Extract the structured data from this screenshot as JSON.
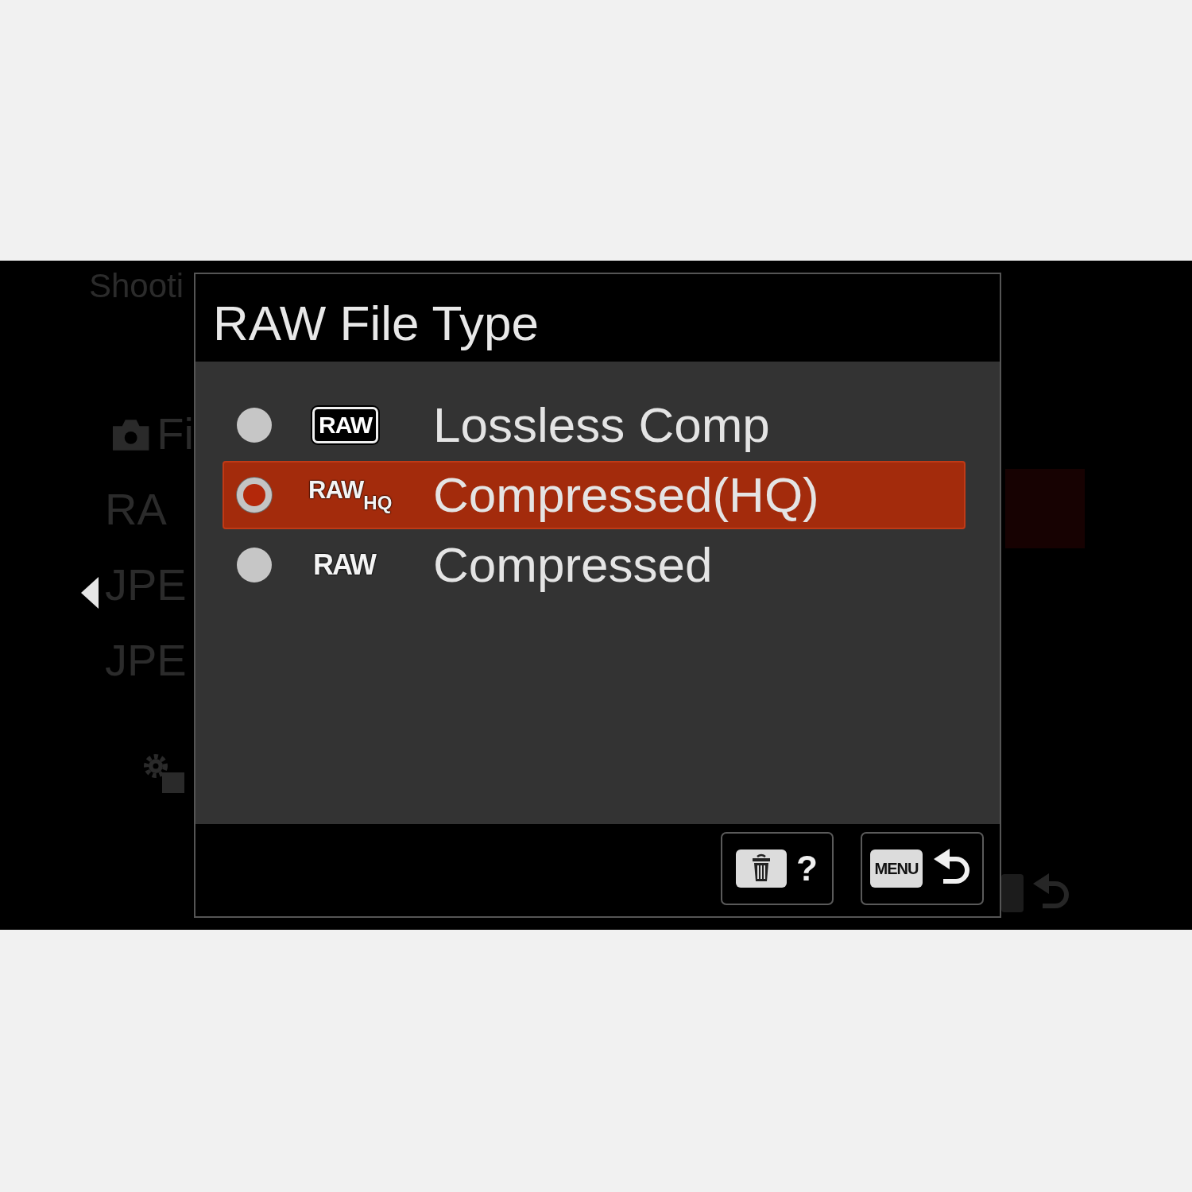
{
  "background_menu": {
    "title": "Shooti",
    "items": [
      {
        "kind": "camera",
        "text": "Fi"
      },
      {
        "kind": "plain",
        "text": "RA"
      },
      {
        "kind": "arrow",
        "text": "JPE"
      },
      {
        "kind": "plain",
        "text": "JPE"
      }
    ]
  },
  "dialog": {
    "title": "RAW File Type",
    "options": [
      {
        "badge": {
          "kind": "boxed",
          "text": "RAW"
        },
        "label": "Lossless Comp",
        "selected": false
      },
      {
        "badge": {
          "kind": "subscript",
          "text": "RAW",
          "sub": "HQ"
        },
        "label": "Compressed(HQ)",
        "selected": true
      },
      {
        "badge": {
          "kind": "plain",
          "text": "RAW"
        },
        "label": "Compressed",
        "selected": false
      }
    ],
    "buttons": [
      {
        "kind": "help",
        "text": "?"
      },
      {
        "kind": "back",
        "key": "MENU"
      }
    ]
  }
}
